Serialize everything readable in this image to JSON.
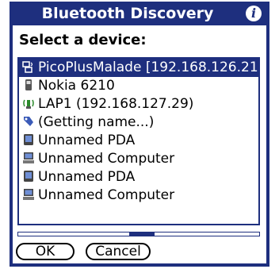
{
  "dialog": {
    "title": "Bluetooth Discovery",
    "prompt": "Select a device:"
  },
  "devices": [
    {
      "label": "PicoPlusMalade [192.168.126.21...",
      "icon": "network-access-point-icon",
      "selected": true
    },
    {
      "label": "Nokia 6210",
      "icon": "phone-icon",
      "selected": false
    },
    {
      "label": "LAP1 (192.168.127.29)",
      "icon": "lan-access-point-icon",
      "selected": false
    },
    {
      "label": "(Getting name...)",
      "icon": "unknown-device-icon",
      "selected": false
    },
    {
      "label": "Unnamed PDA",
      "icon": "pda-icon",
      "selected": false
    },
    {
      "label": "Unnamed Computer",
      "icon": "computer-icon",
      "selected": false
    },
    {
      "label": "Unnamed PDA",
      "icon": "pda-icon",
      "selected": false
    },
    {
      "label": "Unnamed Computer",
      "icon": "computer-icon",
      "selected": false
    }
  ],
  "buttons": {
    "ok_label": "OK",
    "cancel_label": "Cancel"
  },
  "colors": {
    "accent": "#1e2f7e",
    "background": "#ffffff"
  }
}
